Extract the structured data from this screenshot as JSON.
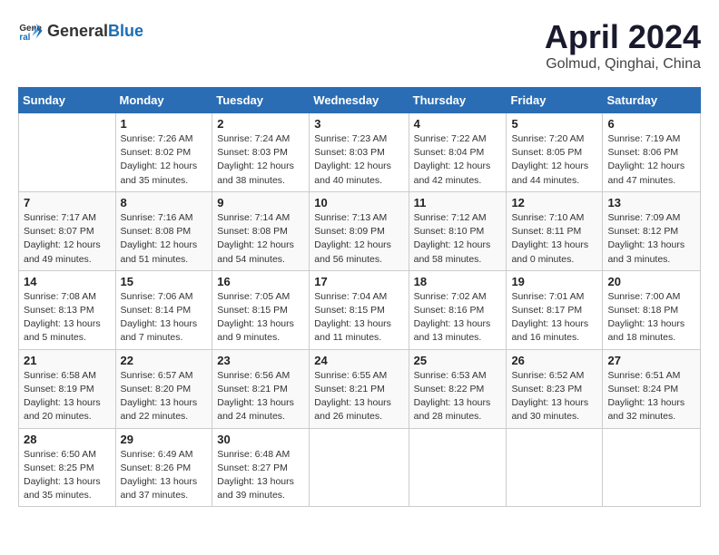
{
  "logo": {
    "general": "General",
    "blue": "Blue"
  },
  "header": {
    "month": "April 2024",
    "location": "Golmud, Qinghai, China"
  },
  "weekdays": [
    "Sunday",
    "Monday",
    "Tuesday",
    "Wednesday",
    "Thursday",
    "Friday",
    "Saturday"
  ],
  "weeks": [
    [
      {
        "day": "",
        "info": ""
      },
      {
        "day": "1",
        "info": "Sunrise: 7:26 AM\nSunset: 8:02 PM\nDaylight: 12 hours\nand 35 minutes."
      },
      {
        "day": "2",
        "info": "Sunrise: 7:24 AM\nSunset: 8:03 PM\nDaylight: 12 hours\nand 38 minutes."
      },
      {
        "day": "3",
        "info": "Sunrise: 7:23 AM\nSunset: 8:03 PM\nDaylight: 12 hours\nand 40 minutes."
      },
      {
        "day": "4",
        "info": "Sunrise: 7:22 AM\nSunset: 8:04 PM\nDaylight: 12 hours\nand 42 minutes."
      },
      {
        "day": "5",
        "info": "Sunrise: 7:20 AM\nSunset: 8:05 PM\nDaylight: 12 hours\nand 44 minutes."
      },
      {
        "day": "6",
        "info": "Sunrise: 7:19 AM\nSunset: 8:06 PM\nDaylight: 12 hours\nand 47 minutes."
      }
    ],
    [
      {
        "day": "7",
        "info": "Sunrise: 7:17 AM\nSunset: 8:07 PM\nDaylight: 12 hours\nand 49 minutes."
      },
      {
        "day": "8",
        "info": "Sunrise: 7:16 AM\nSunset: 8:08 PM\nDaylight: 12 hours\nand 51 minutes."
      },
      {
        "day": "9",
        "info": "Sunrise: 7:14 AM\nSunset: 8:08 PM\nDaylight: 12 hours\nand 54 minutes."
      },
      {
        "day": "10",
        "info": "Sunrise: 7:13 AM\nSunset: 8:09 PM\nDaylight: 12 hours\nand 56 minutes."
      },
      {
        "day": "11",
        "info": "Sunrise: 7:12 AM\nSunset: 8:10 PM\nDaylight: 12 hours\nand 58 minutes."
      },
      {
        "day": "12",
        "info": "Sunrise: 7:10 AM\nSunset: 8:11 PM\nDaylight: 13 hours\nand 0 minutes."
      },
      {
        "day": "13",
        "info": "Sunrise: 7:09 AM\nSunset: 8:12 PM\nDaylight: 13 hours\nand 3 minutes."
      }
    ],
    [
      {
        "day": "14",
        "info": "Sunrise: 7:08 AM\nSunset: 8:13 PM\nDaylight: 13 hours\nand 5 minutes."
      },
      {
        "day": "15",
        "info": "Sunrise: 7:06 AM\nSunset: 8:14 PM\nDaylight: 13 hours\nand 7 minutes."
      },
      {
        "day": "16",
        "info": "Sunrise: 7:05 AM\nSunset: 8:15 PM\nDaylight: 13 hours\nand 9 minutes."
      },
      {
        "day": "17",
        "info": "Sunrise: 7:04 AM\nSunset: 8:15 PM\nDaylight: 13 hours\nand 11 minutes."
      },
      {
        "day": "18",
        "info": "Sunrise: 7:02 AM\nSunset: 8:16 PM\nDaylight: 13 hours\nand 13 minutes."
      },
      {
        "day": "19",
        "info": "Sunrise: 7:01 AM\nSunset: 8:17 PM\nDaylight: 13 hours\nand 16 minutes."
      },
      {
        "day": "20",
        "info": "Sunrise: 7:00 AM\nSunset: 8:18 PM\nDaylight: 13 hours\nand 18 minutes."
      }
    ],
    [
      {
        "day": "21",
        "info": "Sunrise: 6:58 AM\nSunset: 8:19 PM\nDaylight: 13 hours\nand 20 minutes."
      },
      {
        "day": "22",
        "info": "Sunrise: 6:57 AM\nSunset: 8:20 PM\nDaylight: 13 hours\nand 22 minutes."
      },
      {
        "day": "23",
        "info": "Sunrise: 6:56 AM\nSunset: 8:21 PM\nDaylight: 13 hours\nand 24 minutes."
      },
      {
        "day": "24",
        "info": "Sunrise: 6:55 AM\nSunset: 8:21 PM\nDaylight: 13 hours\nand 26 minutes."
      },
      {
        "day": "25",
        "info": "Sunrise: 6:53 AM\nSunset: 8:22 PM\nDaylight: 13 hours\nand 28 minutes."
      },
      {
        "day": "26",
        "info": "Sunrise: 6:52 AM\nSunset: 8:23 PM\nDaylight: 13 hours\nand 30 minutes."
      },
      {
        "day": "27",
        "info": "Sunrise: 6:51 AM\nSunset: 8:24 PM\nDaylight: 13 hours\nand 32 minutes."
      }
    ],
    [
      {
        "day": "28",
        "info": "Sunrise: 6:50 AM\nSunset: 8:25 PM\nDaylight: 13 hours\nand 35 minutes."
      },
      {
        "day": "29",
        "info": "Sunrise: 6:49 AM\nSunset: 8:26 PM\nDaylight: 13 hours\nand 37 minutes."
      },
      {
        "day": "30",
        "info": "Sunrise: 6:48 AM\nSunset: 8:27 PM\nDaylight: 13 hours\nand 39 minutes."
      },
      {
        "day": "",
        "info": ""
      },
      {
        "day": "",
        "info": ""
      },
      {
        "day": "",
        "info": ""
      },
      {
        "day": "",
        "info": ""
      }
    ]
  ]
}
